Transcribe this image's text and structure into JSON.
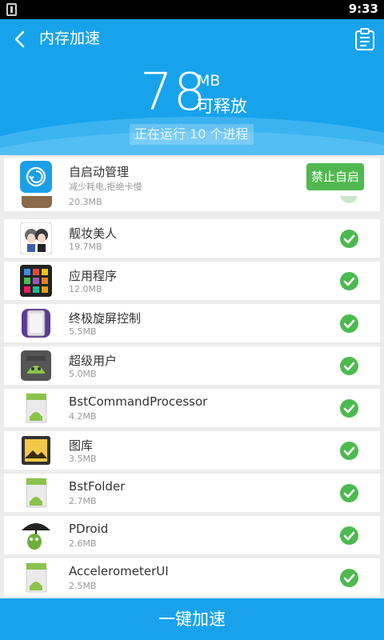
{
  "status_bar": {
    "time": "9:33"
  },
  "header": {
    "title": "内存加速",
    "freeable_amount": "78",
    "unit": "MB",
    "freeable_label": "可释放",
    "running_text": "正在运行 10 个进程",
    "accent_color": "#17a3ec"
  },
  "autostart": {
    "title": "自启动管理",
    "subtitle": "减少耗电,拒绝卡慢",
    "button_label": "禁止自启",
    "button_color": "#50b84f"
  },
  "partial_item": {
    "size": "20.3MB"
  },
  "apps": [
    {
      "name": "靓妆美人",
      "size": "19.7MB",
      "icon": "beauty-app-icon",
      "checked": true
    },
    {
      "name": "应用程序",
      "size": "12.0MB",
      "icon": "app-grid-icon",
      "checked": true
    },
    {
      "name": "终极旋屏控制",
      "size": "5.5MB",
      "icon": "rotate-screen-icon",
      "checked": true
    },
    {
      "name": "超级用户",
      "size": "5.0MB",
      "icon": "superuser-icon",
      "checked": true
    },
    {
      "name": "BstCommandProcessor",
      "size": "4.2MB",
      "icon": "android-app-icon",
      "checked": true
    },
    {
      "name": "图库",
      "size": "3.5MB",
      "icon": "gallery-icon",
      "checked": true
    },
    {
      "name": "BstFolder",
      "size": "2.7MB",
      "icon": "android-app-icon",
      "checked": true
    },
    {
      "name": "PDroid",
      "size": "2.6MB",
      "icon": "pdroid-icon",
      "checked": true
    },
    {
      "name": "AccelerometerUI",
      "size": "2.5MB",
      "icon": "android-app-icon",
      "checked": true
    }
  ],
  "bottom_button": {
    "label": "一键加速",
    "color": "#1aa3ec"
  },
  "check_color": "#4cba4f"
}
